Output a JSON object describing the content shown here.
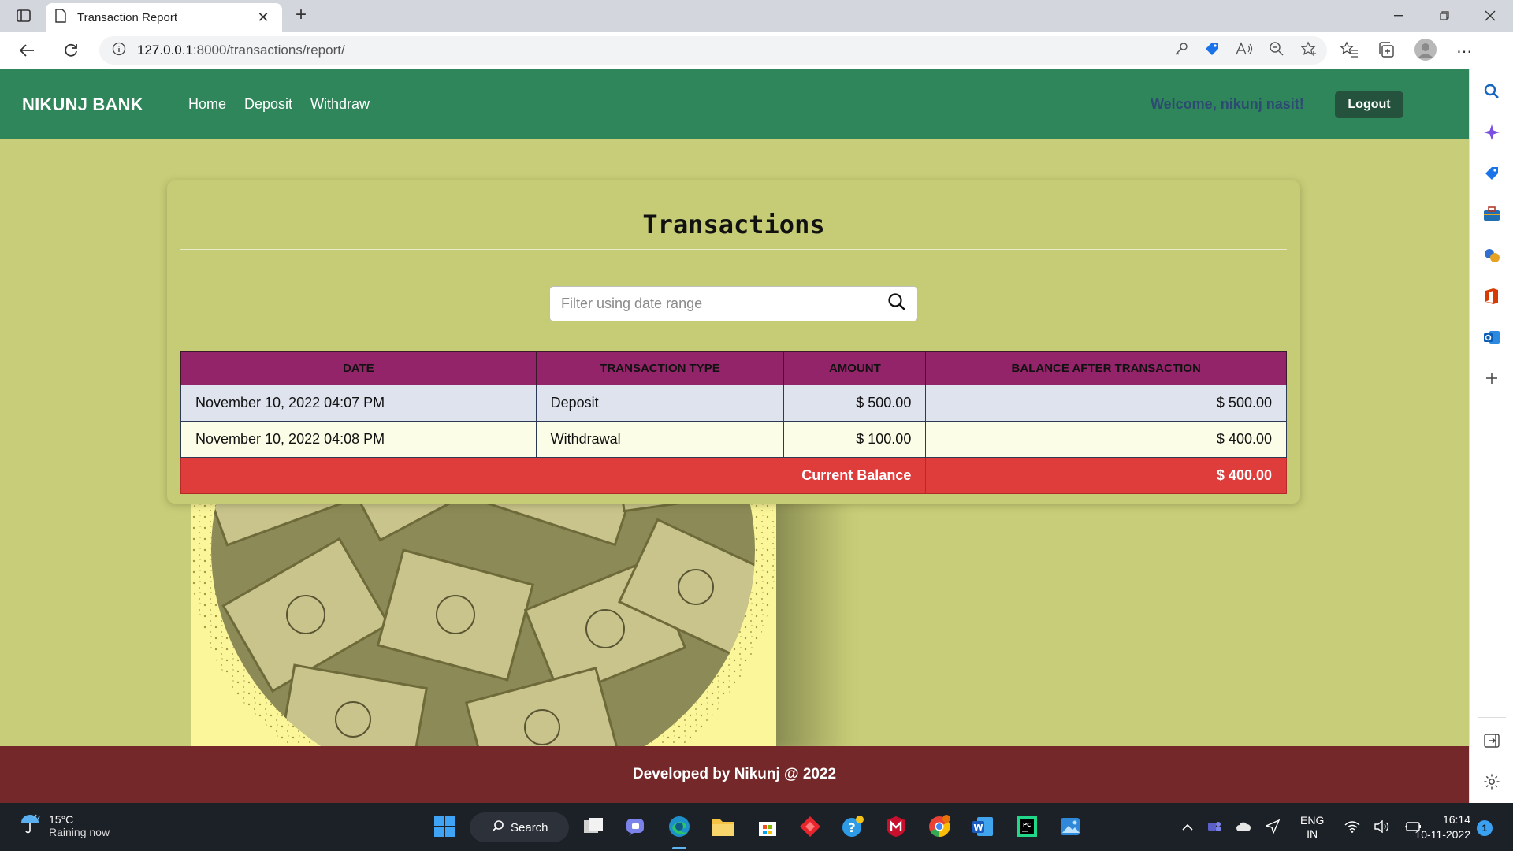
{
  "browser": {
    "tab_title": "Transaction Report",
    "url_host": "127.0.0.1",
    "url_path": ":8000/transactions/report/",
    "new_tab_label": "+"
  },
  "navbar": {
    "brand": "NIKUNJ BANK",
    "links": [
      "Home",
      "Deposit",
      "Withdraw"
    ],
    "welcome": "Welcome, nikunj nasit!",
    "logout_label": "Logout",
    "colors": {
      "navbar": "#2e865a",
      "welcome": "#2d4a72",
      "logout": "#24523c"
    }
  },
  "main": {
    "title": "Transactions",
    "filter_placeholder": "Filter using date range",
    "table": {
      "headers": [
        "DATE",
        "TRANSACTION TYPE",
        "AMOUNT",
        "BALANCE AFTER TRANSACTION"
      ],
      "rows": [
        {
          "date": "November 10, 2022 04:07 PM",
          "type": "Deposit",
          "amount": "$ 500.00",
          "balance": "$ 500.00"
        },
        {
          "date": "November 10, 2022 04:08 PM",
          "type": "Withdrawal",
          "amount": "$ 100.00",
          "balance": "$ 400.00"
        }
      ],
      "current_balance_label": "Current Balance",
      "current_balance_value": "$ 400.00",
      "colors": {
        "header": "#94246a",
        "balance_row": "#df3c3c"
      }
    }
  },
  "footer": {
    "text": "Developed by Nikunj @ 2022",
    "color": "#75282a"
  },
  "taskbar": {
    "weather_temp": "15°C",
    "weather_condition": "Raining now",
    "search_label": "Search",
    "language_top": "ENG",
    "language_bottom": "IN",
    "time": "16:14",
    "date": "10-11-2022",
    "notification_count": "1"
  }
}
